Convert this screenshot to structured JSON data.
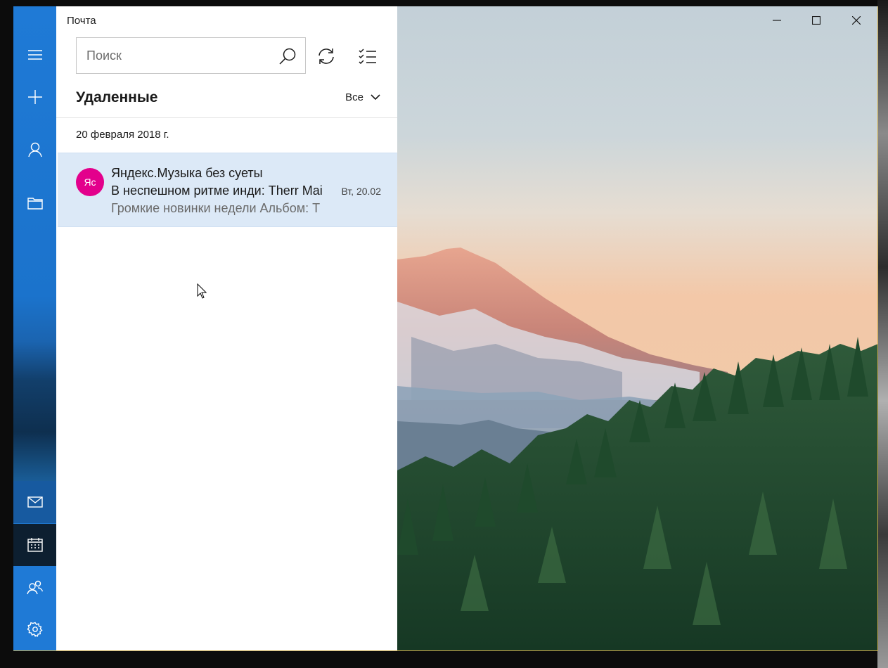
{
  "app": {
    "title": "Почта"
  },
  "search": {
    "placeholder": "Поиск"
  },
  "toolbar": {
    "sync_icon": "sync-icon",
    "select_icon": "select-mode-icon"
  },
  "rail": {
    "items": [
      {
        "icon": "hamburger-menu-icon"
      },
      {
        "icon": "new-mail-icon"
      },
      {
        "icon": "accounts-icon"
      },
      {
        "icon": "folders-icon"
      },
      {
        "icon": "mail-icon",
        "active": true
      },
      {
        "icon": "calendar-icon"
      },
      {
        "icon": "people-icon"
      },
      {
        "icon": "settings-icon"
      }
    ]
  },
  "folder": {
    "title": "Удаленные",
    "filter_label": "Все"
  },
  "messages": {
    "date_group": "20 февраля 2018 г.",
    "items": [
      {
        "avatar_initials": "Яс",
        "sender": "Яндекс.Музыка без суеты",
        "subject": "В неспешном ритме инди: Therr Mai",
        "date": "Вт, 20.02",
        "preview": "Громкие новинки недели Альбом: Т"
      }
    ]
  },
  "window_controls": {
    "minimize": "minimize-icon",
    "maximize": "maximize-icon",
    "close": "close-icon"
  },
  "colors": {
    "rail_blue": "#1f7ad6",
    "avatar_magenta": "#e3008c",
    "selected_row": "#dce9f7"
  }
}
